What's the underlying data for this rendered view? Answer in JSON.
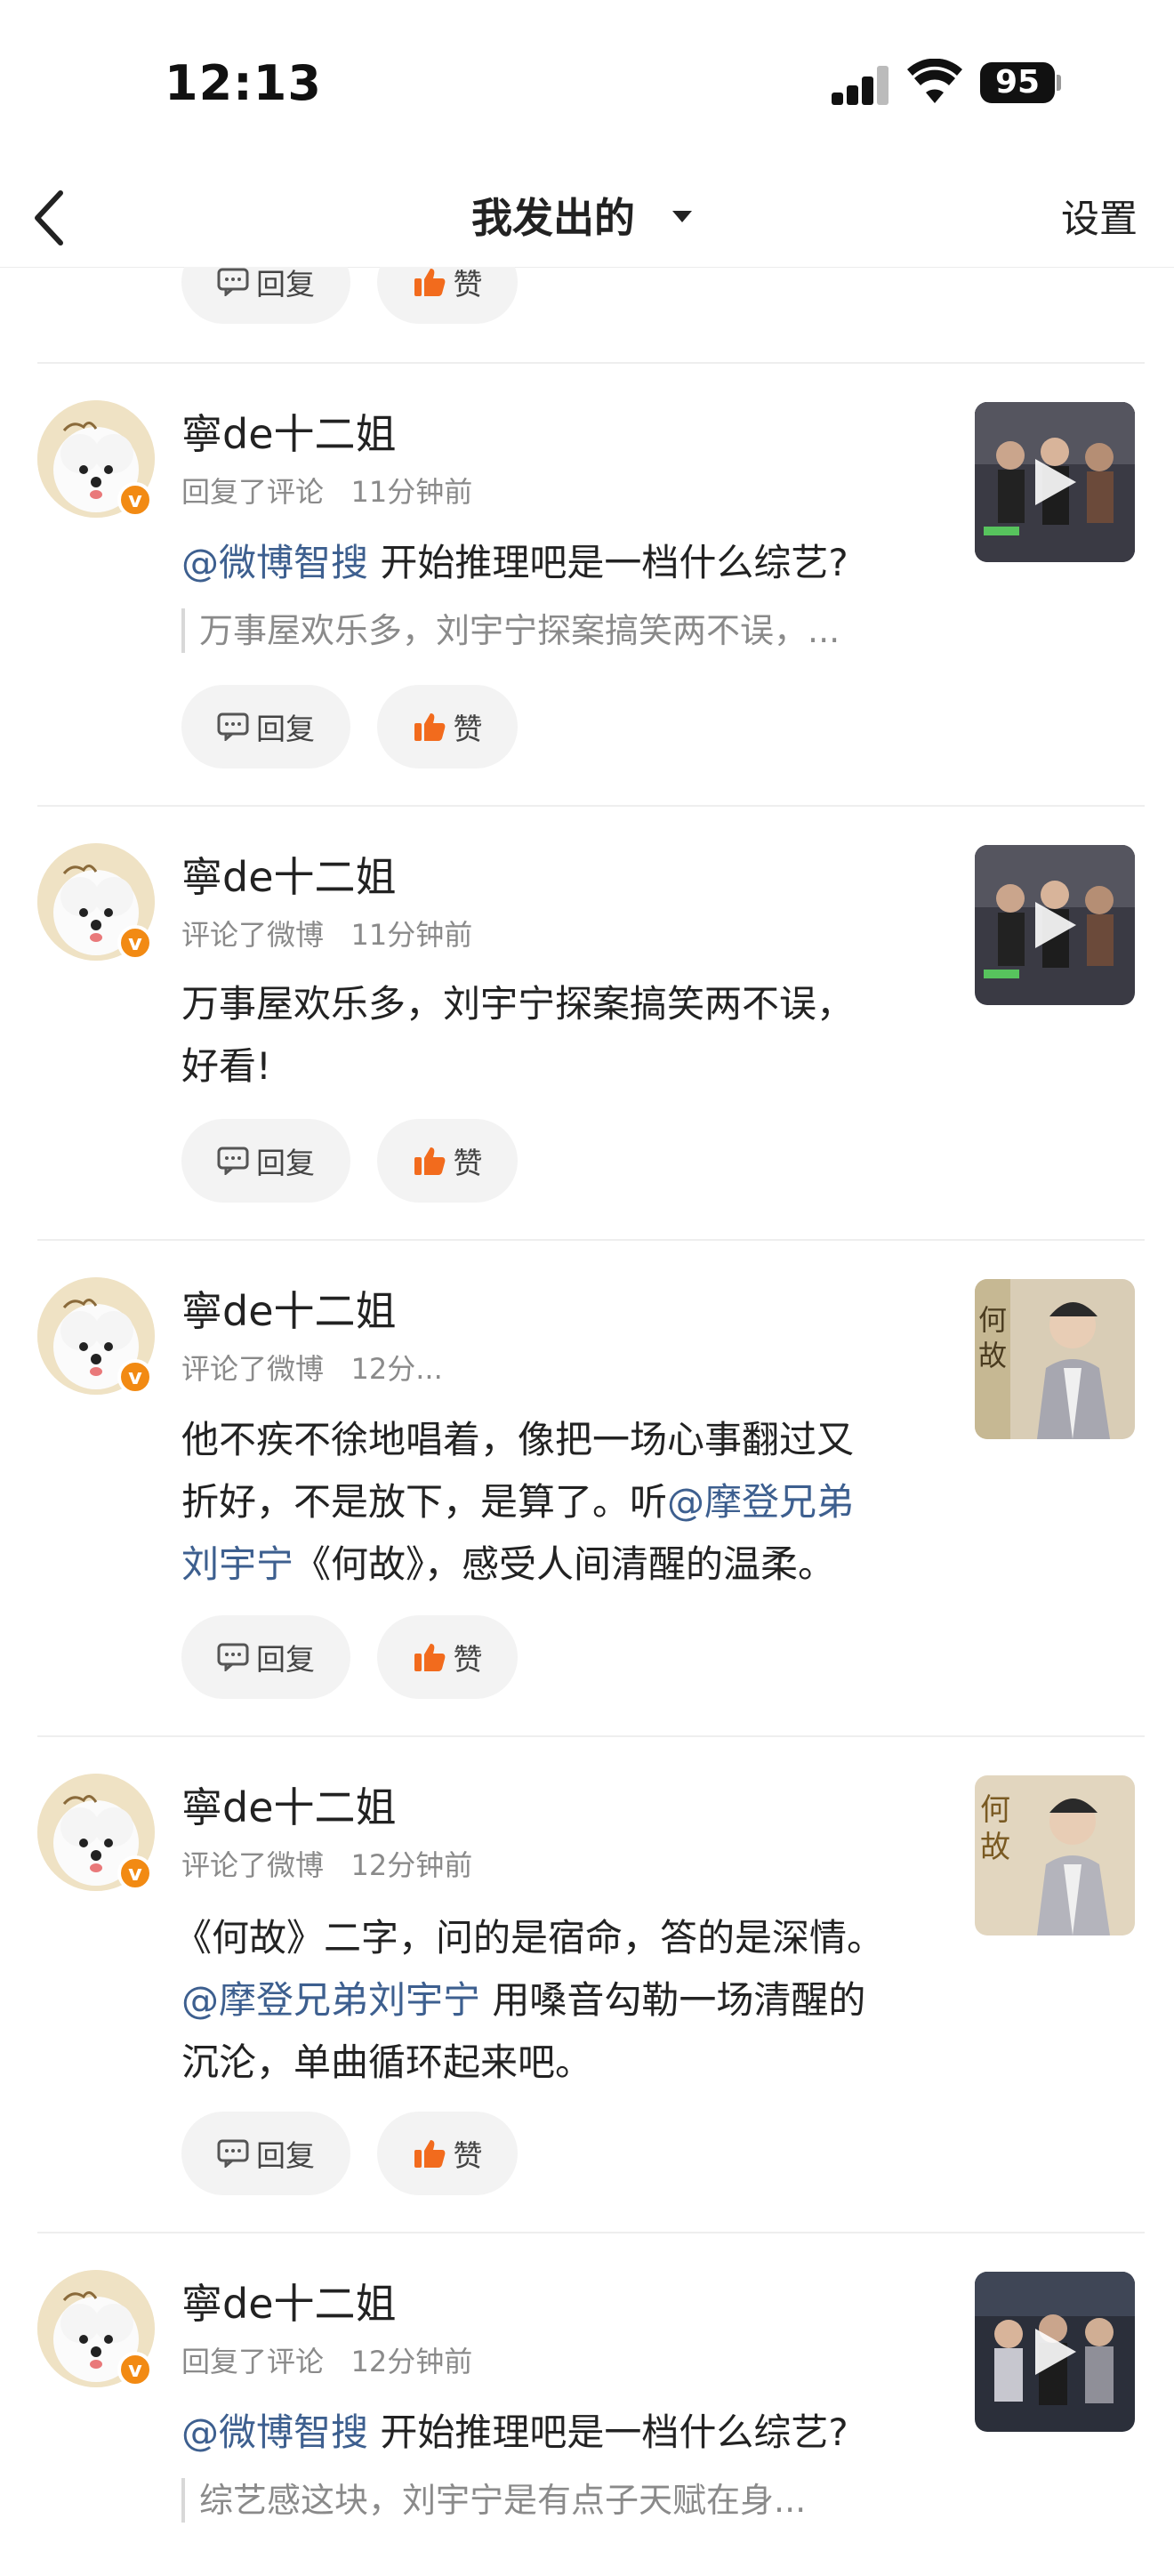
{
  "status": {
    "time": "12:13",
    "battery": "95"
  },
  "nav": {
    "title": "我发出的",
    "settings": "设置"
  },
  "buttons": {
    "reply": "回复",
    "like": "赞"
  },
  "items": [
    {
      "name": "寧de十二姐",
      "action": "回复了评论",
      "time": "11分钟前",
      "mention": "@微博智搜",
      "text": " 开始推理吧是一档什么综艺?",
      "quote": "万事屋欢乐多，刘宇宁探案搞笑两不误，..."
    },
    {
      "name": "寧de十二姐",
      "action": "评论了微博",
      "time": "11分钟前",
      "line1": "万事屋欢乐多，刘宇宁探案搞笑两不误，",
      "line2": "好看!"
    },
    {
      "name": "寧de十二姐",
      "action": "评论了微博",
      "time": "12分...",
      "line1": "他不疾不徐地唱着，像把一场心事翻过又",
      "line2a": "折好，不是放下，是算了。听",
      "mention": "@摩登兄弟",
      "mention2": "刘宇宁",
      "line3": "《何故》，感受人间清醒的温柔。",
      "thumb_text": "何故"
    },
    {
      "name": "寧de十二姐",
      "action": "评论了微博",
      "time": "12分钟前",
      "line1": "《何故》二字，问的是宿命，答的是深情。",
      "mention": "@摩登兄弟刘宇宁",
      "line2": " 用嗓音勾勒一场清醒的",
      "line3": "沉沦，单曲循环起来吧。",
      "thumb_text": "何故"
    },
    {
      "name": "寧de十二姐",
      "action": "回复了评论",
      "time": "12分钟前",
      "mention": "@微博智搜",
      "text": " 开始推理吧是一档什么综艺?",
      "quote": "综艺感这块，刘宇宁是有点子天赋在身..."
    }
  ]
}
